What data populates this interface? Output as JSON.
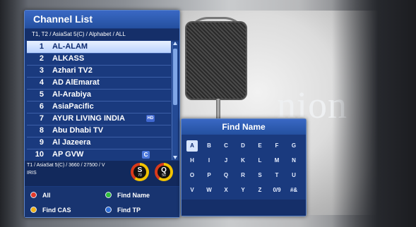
{
  "background": {
    "overlay_text": "nion",
    "overlay_subtext": "s"
  },
  "channel_list": {
    "title": "Channel List",
    "path": "T1, T2 / AsiaSat 5(C) / Alphabet / ALL",
    "selected_index": 0,
    "channels": [
      {
        "num": "1",
        "name": "AL-ALAM",
        "badge": ""
      },
      {
        "num": "2",
        "name": "ALKASS",
        "badge": ""
      },
      {
        "num": "3",
        "name": "Azhari TV2",
        "badge": ""
      },
      {
        "num": "4",
        "name": "AD AlEmarat",
        "badge": ""
      },
      {
        "num": "5",
        "name": "Al-Arabiya",
        "badge": ""
      },
      {
        "num": "6",
        "name": "AsiaPacific",
        "badge": ""
      },
      {
        "num": "7",
        "name": "AYUR LIVING INDIA",
        "badge": "HD"
      },
      {
        "num": "8",
        "name": "Abu Dhabi TV",
        "badge": ""
      },
      {
        "num": "9",
        "name": "Al Jazeera",
        "badge": ""
      },
      {
        "num": "10",
        "name": "AP GVW",
        "badge": "C"
      }
    ],
    "info_line1": "T1 / AsiaSat 5(C) / 3660 / 27500 / V",
    "info_line2": "IRIS",
    "signal": {
      "label": "S",
      "value": "70"
    },
    "quality": {
      "label": "Q",
      "value": "50"
    },
    "legend": [
      {
        "label": "All",
        "color": "#e23a2a"
      },
      {
        "label": "Find Name",
        "color": "#2fbf3a"
      },
      {
        "label": "Find CAS",
        "color": "#f0b21a"
      },
      {
        "label": "Find TP",
        "color": "#2d6ed8"
      }
    ]
  },
  "find_name": {
    "title": "Find Name",
    "selected_key": "A",
    "keys": [
      [
        "A",
        "B",
        "C",
        "D",
        "E",
        "F",
        "G"
      ],
      [
        "H",
        "I",
        "J",
        "K",
        "L",
        "M",
        "N"
      ],
      [
        "O",
        "P",
        "Q",
        "R",
        "S",
        "T",
        "U"
      ],
      [
        "V",
        "W",
        "X",
        "Y",
        "Z",
        "0/9",
        "#&"
      ]
    ]
  }
}
